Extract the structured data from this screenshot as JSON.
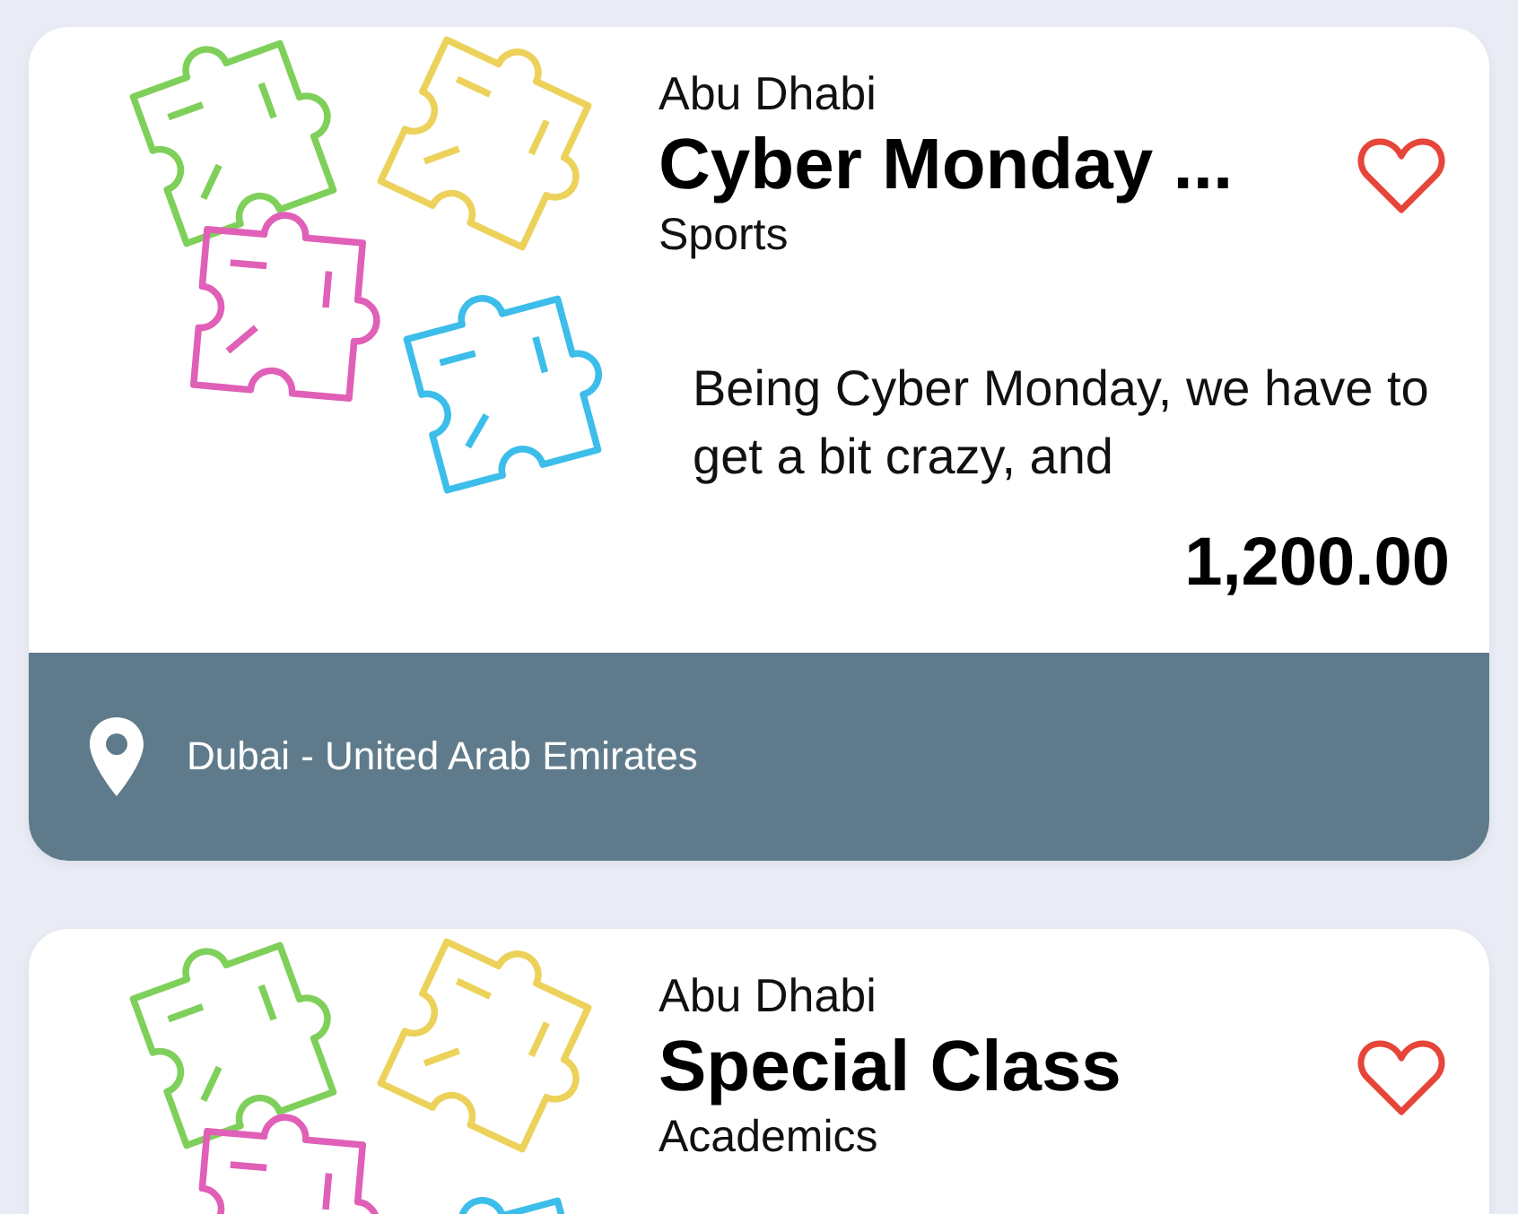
{
  "cards": [
    {
      "city": "Abu Dhabi",
      "title": "Cyber Monday ...",
      "category": "Sports",
      "favorite": false,
      "description": "Being Cyber Monday, we have to get a bit crazy, and",
      "price": "1,200.00",
      "location": "Dubai - United Arab Emirates"
    },
    {
      "city": "Abu Dhabi",
      "title": "Special Class",
      "category": "Academics",
      "favorite": false
    }
  ]
}
